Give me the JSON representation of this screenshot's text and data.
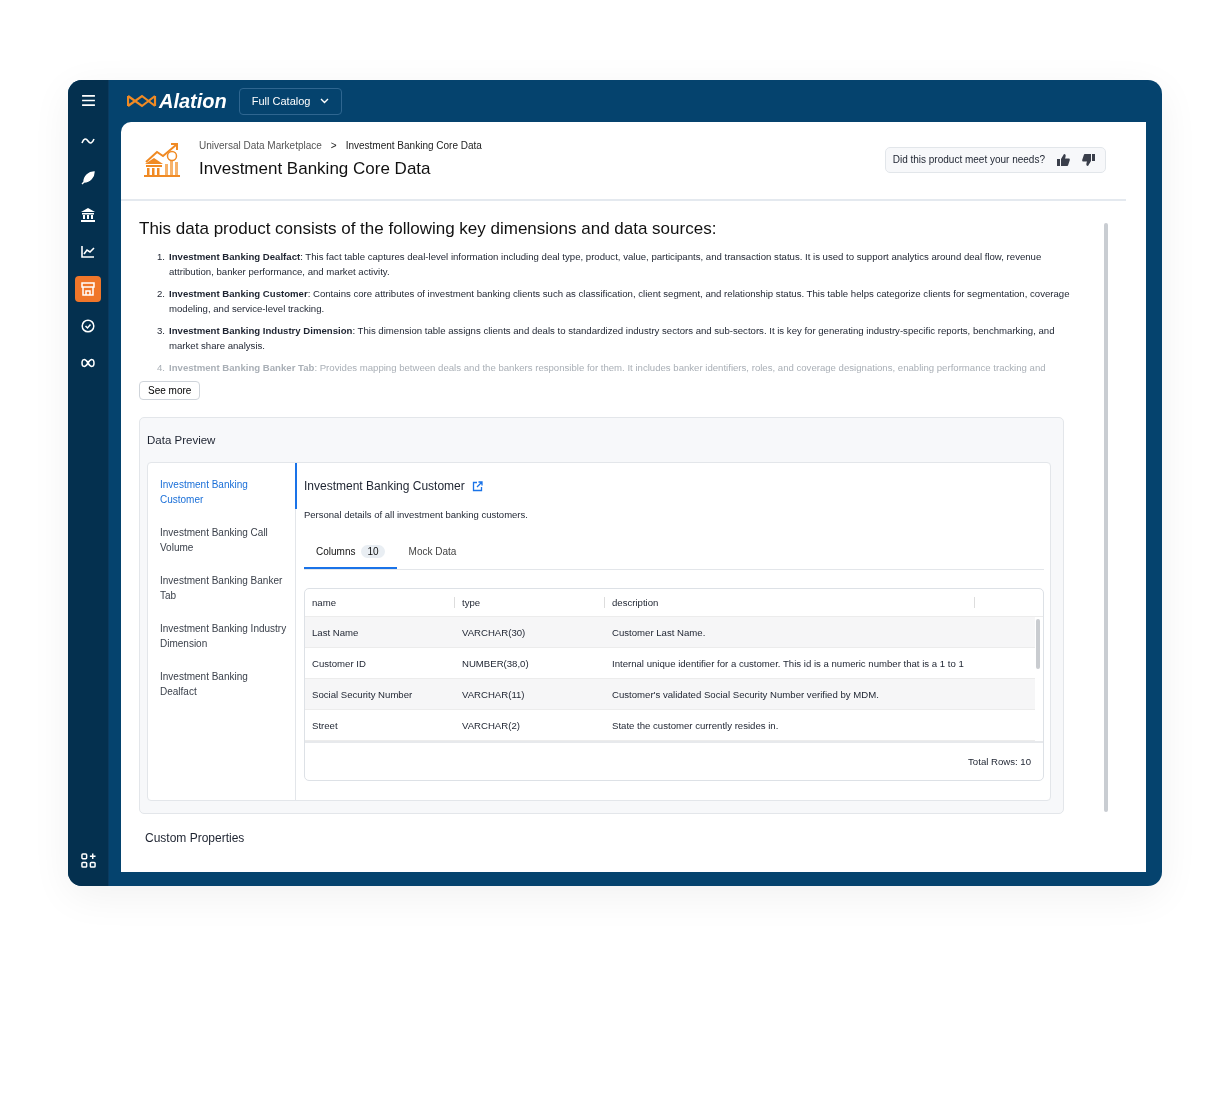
{
  "app": {
    "brand": "Alation",
    "catalog_selector": "Full Catalog"
  },
  "rail": {
    "items": [
      {
        "kind": "route",
        "selected": false
      },
      {
        "kind": "feather",
        "selected": false
      },
      {
        "kind": "bank",
        "selected": false
      },
      {
        "kind": "chart",
        "selected": false
      },
      {
        "kind": "store",
        "selected": true
      },
      {
        "kind": "badge",
        "selected": false
      },
      {
        "kind": "loop",
        "selected": false
      }
    ]
  },
  "header": {
    "breadcrumbs": [
      "Universal Data Marketplace",
      "Investment Banking Core Data"
    ],
    "separator": ">",
    "title": "Investment Banking Core Data",
    "feedback": {
      "question": "Did this product meet your needs?"
    }
  },
  "summary": {
    "heading": "This data product consists of the following key dimensions and data sources:",
    "items": [
      {
        "number": "1.",
        "text": "**Investment Banking Dealfact**: This fact table captures deal-level information including deal type, product, value, participants, and transaction status. It is used to support analytics around deal flow, revenue attribution, banker performance, and market activity.",
        "faded": false
      },
      {
        "number": "2.",
        "text": "**Investment Banking Customer**: Contains core attributes of investment banking clients such as classification, client segment, and relationship status. This table helps categorize clients for segmentation, coverage modeling, and service-level tracking.",
        "faded": false
      },
      {
        "number": "3.",
        "text": "**Investment Banking Industry Dimension**: This dimension table assigns clients and deals to standardized industry sectors and sub-sectors. It is key for generating industry-specific reports, benchmarking, and market share analysis.",
        "faded": false
      },
      {
        "number": "4.",
        "text": "**Investment Banking Banker Tab**: Provides mapping between deals and the bankers responsible for them. It includes banker identifiers, roles, and coverage designations, enabling performance tracking and",
        "faded": true
      }
    ],
    "see_more": "See more"
  },
  "data_preview": {
    "title": "Data Preview",
    "tables": [
      {
        "label": "Investment Banking Customer",
        "selected": true
      },
      {
        "label": "Investment Banking Call Volume",
        "selected": false
      },
      {
        "label": "Investment Banking Banker Tab",
        "selected": false
      },
      {
        "label": "Investment Banking Industry Dimension",
        "selected": false
      },
      {
        "label": "Investment Banking Dealfact",
        "selected": false
      }
    ],
    "detail": {
      "title": "Investment Banking Customer",
      "description": "Personal details of all investment banking customers.",
      "tabs": [
        {
          "label": "Columns",
          "count": "10",
          "selected": true
        },
        {
          "label": "Mock Data",
          "selected": false
        }
      ],
      "table": {
        "columns": [
          "name",
          "type",
          "description"
        ],
        "rows": [
          [
            "Last Name",
            "VARCHAR(30)",
            "Customer Last Name."
          ],
          [
            "Customer ID",
            "NUMBER(38,0)",
            "Internal unique identifier for a customer. This id is a numeric number that is a 1 to 1"
          ],
          [
            "Social Security Number",
            "VARCHAR(11)",
            "Customer's validated Social Security Number verified by MDM."
          ],
          [
            "Street",
            "VARCHAR(2)",
            "State the customer currently resides in."
          ]
        ],
        "total_rows": "Total Rows: 10"
      }
    }
  },
  "custom_properties": {
    "title": "Custom Properties"
  }
}
